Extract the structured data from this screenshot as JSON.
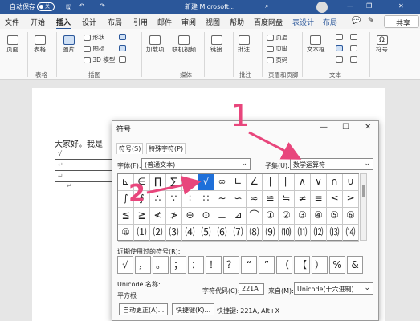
{
  "titlebar": {
    "autosave": "自动保存",
    "toggle": "关",
    "doc": "新建 Microsoft..."
  },
  "tabs": [
    "文件",
    "开始",
    "插入",
    "设计",
    "布局",
    "引用",
    "邮件",
    "审阅",
    "视图",
    "帮助",
    "百度网盘",
    "表设计",
    "布局"
  ],
  "share": "共享",
  "ribbon": {
    "page": "页面",
    "table": "表格",
    "picture": "图片",
    "shapes": "形状",
    "icons": "图标",
    "model3d": "3D 模型",
    "addins": "加载项",
    "onlinevideo": "联机视频",
    "link": "链接",
    "comment": "批注",
    "header": "页眉",
    "footer": "页脚",
    "pagenum": "页码",
    "textbox": "文本框",
    "symbol": "符号",
    "groups": {
      "tables": "表格",
      "illustrations": "插图",
      "media": "媒体",
      "comments": "批注",
      "headerfooter": "页眉和页脚",
      "text": "文本"
    }
  },
  "document": {
    "line1": "大家好。我是",
    "cellmark": "√"
  },
  "dialog": {
    "title": "符号",
    "tab1": "符号(S)",
    "tab2": "特殊字符(P)",
    "font_label": "字体(F):",
    "font_value": "(普通文本)",
    "subset_label": "子集(U):",
    "subset_value": "数学运算符",
    "grid": [
      [
        "⊾",
        "∈",
        "∏",
        "∑",
        "−",
        "√",
        "∞",
        "∟",
        "∠",
        "∣",
        "∥",
        "∧",
        "∨",
        "∩",
        "∪"
      ],
      [
        "∫",
        "∮",
        "∴",
        "∵",
        "∶",
        "∷",
        "∼",
        "∽",
        "≈",
        "≌",
        "≒",
        "≠",
        "≡",
        "≤",
        "≥"
      ],
      [
        "≦",
        "≧",
        "≮",
        "≯",
        "⊕",
        "⊙",
        "⊥",
        "⊿",
        "⌒",
        "①",
        "②",
        "③",
        "④",
        "⑤",
        "⑥"
      ],
      [
        "⑩",
        "⑴",
        "⑵",
        "⑶",
        "⑷",
        "⑸",
        "⑹",
        "⑺",
        "⑻",
        "⑼",
        "⑽",
        "⑾",
        "⑿",
        "⒀",
        "⒁"
      ]
    ],
    "recent_label": "近期使用过的符号(R):",
    "recent": [
      "√",
      "，",
      "。",
      "；",
      "：",
      "！",
      "？",
      "“",
      "”",
      "（",
      "【",
      "）",
      "%",
      "&"
    ],
    "unicode_label": "Unicode 名称:",
    "unicode_name": "平方根",
    "code_label": "字符代码(C):",
    "code_value": "221A",
    "from_label": "来自(M):",
    "from_value": "Unicode(十六进制)",
    "autocorrect": "自动更正(A)...",
    "shortcut_btn": "快捷键(K)...",
    "shortcut_text": "快捷键: 221A, Alt+X"
  },
  "annotations": {
    "one": "1",
    "two": "2"
  }
}
